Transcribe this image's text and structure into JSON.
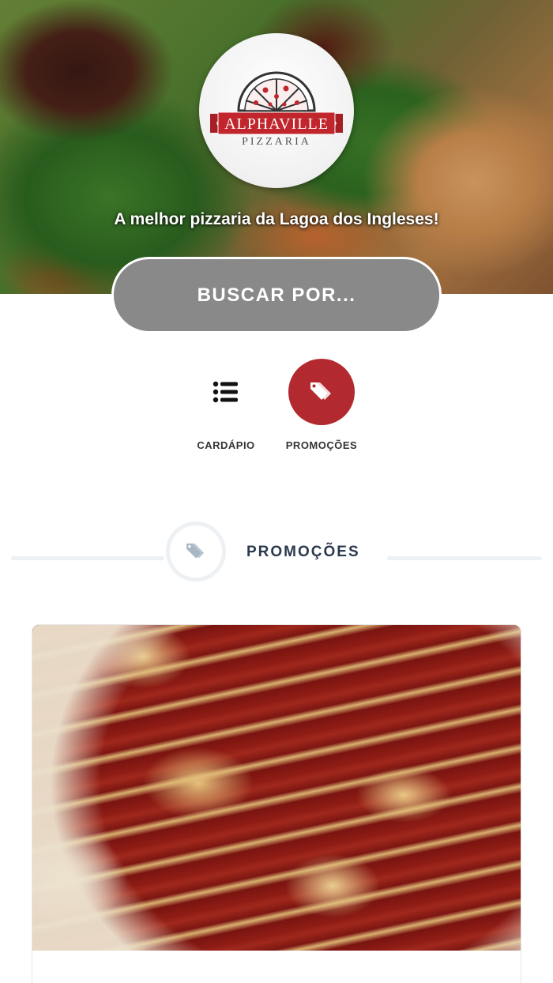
{
  "hero": {
    "logo": {
      "brand": "ALPHAVILLE",
      "subtitle": "PIZZARIA"
    },
    "tagline": "A melhor pizzaria da Lagoa dos Ingleses!",
    "search_button_label": "BUSCAR POR..."
  },
  "nav": {
    "items": [
      {
        "label": "CARDÁPIO",
        "icon": "list-icon"
      },
      {
        "label": "PROMOÇÕES",
        "icon": "tag-icon"
      }
    ]
  },
  "section": {
    "title": "PROMOÇÕES",
    "icon": "tag-icon"
  },
  "colors": {
    "brand_red": "#b22a2f",
    "search_gray": "#898989",
    "section_title": "#2c3a4f"
  }
}
